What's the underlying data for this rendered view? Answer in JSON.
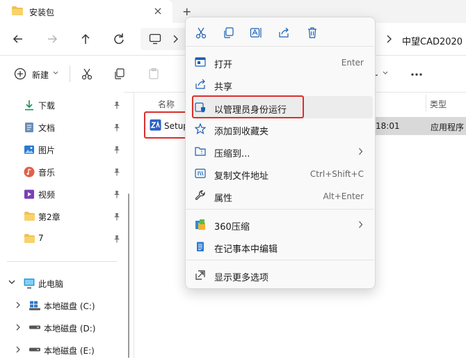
{
  "window": {
    "tab_title": "安装包",
    "tab_add": "+"
  },
  "address": {
    "crumb": "中望CAD2020"
  },
  "command_bar": {
    "new_label": "新建"
  },
  "sidebar": {
    "quick_access": [
      {
        "label": "下载",
        "icon": "download-icon"
      },
      {
        "label": "文档",
        "icon": "document-icon"
      },
      {
        "label": "图片",
        "icon": "picture-icon"
      },
      {
        "label": "音乐",
        "icon": "music-icon"
      },
      {
        "label": "视频",
        "icon": "video-icon"
      },
      {
        "label": "第2章",
        "icon": "folder-icon"
      },
      {
        "label": "7",
        "icon": "folder-icon"
      }
    ],
    "this_pc": "此电脑",
    "drives": [
      {
        "label": "本地磁盘 (C:)"
      },
      {
        "label": "本地磁盘 (D:)"
      },
      {
        "label": "本地磁盘 (E:)"
      }
    ]
  },
  "file_list": {
    "col_name": "名称",
    "col_type": "类型",
    "file": {
      "name": "Setup",
      "time": "18:01",
      "type": "应用程序"
    }
  },
  "context_menu": {
    "items": [
      {
        "label": "打开",
        "shortcut": "Enter"
      },
      {
        "label": "共享",
        "shortcut": ""
      },
      {
        "label": "以管理员身份运行",
        "shortcut": ""
      },
      {
        "label": "添加到收藏夹",
        "shortcut": ""
      },
      {
        "label": "压缩到...",
        "shortcut": ""
      },
      {
        "label": "复制文件地址",
        "shortcut": "Ctrl+Shift+C"
      },
      {
        "label": "属性",
        "shortcut": "Alt+Enter"
      },
      {
        "label": "360压缩",
        "shortcut": ""
      },
      {
        "label": "在记事本中编辑",
        "shortcut": ""
      },
      {
        "label": "显示更多选项",
        "shortcut": ""
      }
    ]
  },
  "colors": {
    "highlight_box": "#d9302c",
    "folder": "#f2c14e",
    "accent": "#0067c0"
  }
}
